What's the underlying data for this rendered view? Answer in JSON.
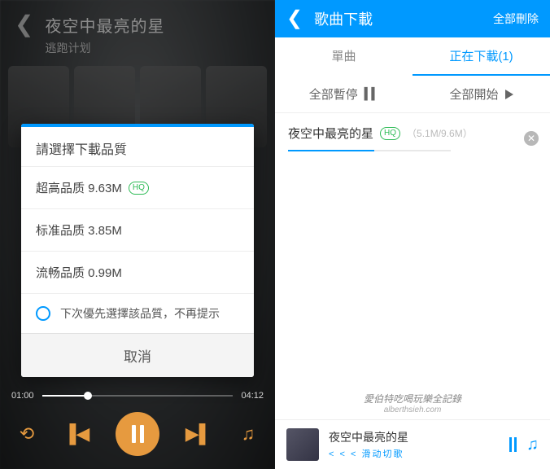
{
  "left": {
    "header": {
      "title": "夜空中最亮的星",
      "subtitle": "逃跑计划"
    },
    "dialog": {
      "title": "請選擇下載品質",
      "options": [
        {
          "label": "超高品质 9.63M",
          "hq": true
        },
        {
          "label": "标准品质 3.85M",
          "hq": false
        },
        {
          "label": "流畅品质 0.99M",
          "hq": false
        }
      ],
      "remember": "下次優先選擇該品質，不再提示",
      "cancel": "取消"
    },
    "player": {
      "elapsed": "01:00",
      "total": "04:12"
    }
  },
  "right": {
    "header": {
      "title": "歌曲下載",
      "delete_all": "全部刪除"
    },
    "tabs": {
      "single": "單曲",
      "downloading": "正在下載(1)"
    },
    "actions": {
      "pause_all": "全部暫停",
      "start_all": "全部開始"
    },
    "item": {
      "name": "夜空中最亮的星",
      "size": "（5.1M/9.6M）"
    },
    "watermark": {
      "line1": "愛伯特吃喝玩樂全記錄",
      "line2": "alberthsieh.com"
    },
    "mini": {
      "title": "夜空中最亮的星",
      "subtitle": "< < < 滑动切歌"
    }
  },
  "colors": {
    "accent_blue": "#0099ff",
    "accent_orange": "#e69a3f",
    "hq_green": "#2dbb55"
  }
}
